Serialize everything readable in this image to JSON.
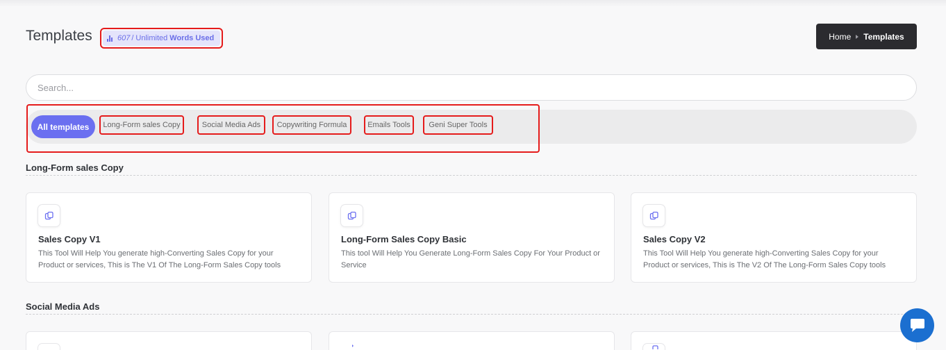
{
  "header": {
    "title": "Templates",
    "usage": {
      "count": "607",
      "separator": "/",
      "limit": "Unlimited",
      "suffix": "Words Used",
      "icon": "bar-chart-icon"
    },
    "breadcrumb": {
      "home": "Home",
      "current": "Templates"
    }
  },
  "search": {
    "placeholder": "Search...",
    "value": ""
  },
  "filters": {
    "active": "All templates",
    "items": [
      "Long-Form sales Copy",
      "Social Media Ads",
      "Copywriting Formula",
      "Emails Tools",
      "Geni Super Tools"
    ]
  },
  "sections": [
    {
      "title": "Long-Form sales Copy",
      "cards": [
        {
          "title": "Sales Copy V1",
          "description": "This Tool Will Help You generate high-Converting Sales Copy for your Product or services, This is The V1 Of The Long-Form Sales Copy tools",
          "icon": "copy-icon"
        },
        {
          "title": "Long-Form Sales Copy Basic",
          "description": "This tool Will Help You Generate Long-Form Sales Copy For Your Product or Service",
          "icon": "copy-icon"
        },
        {
          "title": "Sales Copy V2",
          "description": "This Tool Will Help You generate high-Converting Sales Copy for your Product or services, This is The V2 Of The Long-Form Sales Copy tools",
          "icon": "copy-icon"
        }
      ]
    },
    {
      "title": "Social Media Ads"
    }
  ],
  "colors": {
    "accent": "#6b6ff0",
    "highlight": "#e51b1b",
    "chat": "#1b6fd0",
    "breadcrumb_bg": "#2b2b2f"
  }
}
